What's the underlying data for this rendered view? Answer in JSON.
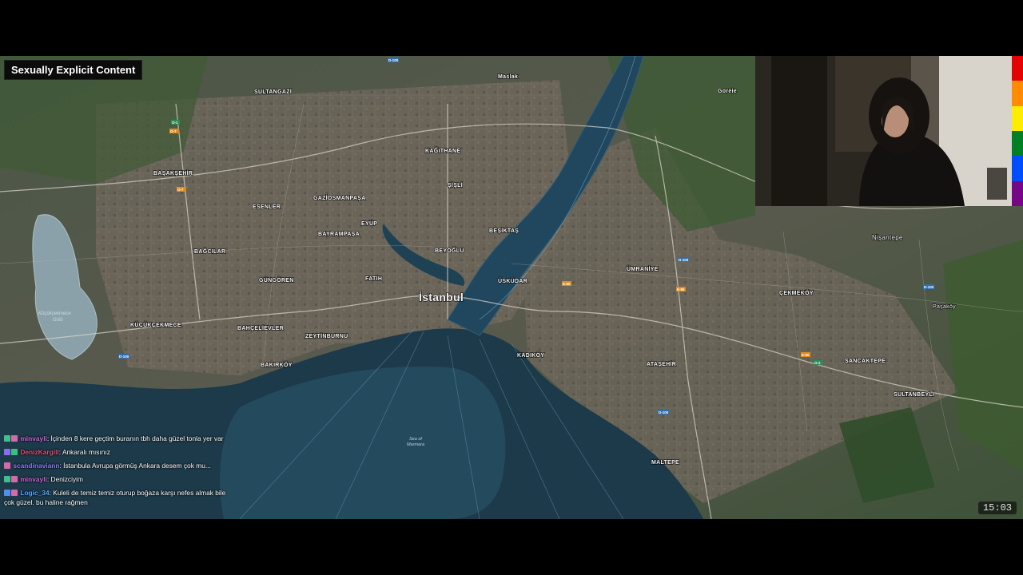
{
  "overlay": {
    "content_label": "Sexually Explicit Content",
    "clock": "15:03"
  },
  "map": {
    "city_label": "İstanbul",
    "sea_label_1": "Sea of",
    "sea_label_2": "Marmara",
    "lake_label_1": "Küçükçekmece",
    "lake_label_2": "Gölü",
    "district_labels": {
      "maslak": "Maslak",
      "sultangazi": "SULTANGAZİ",
      "basaksehir": "BAŞAKŞEHİR",
      "kagithane": "KAĞITHANE",
      "sisli": "ŞİŞLİ",
      "gaziosmanpasa": "GAZİOSMANPAŞA",
      "esenler": "ESENLER",
      "eyup": "EYÜP",
      "bayrampasa": "BAYRAMPAŞA",
      "besiktas": "BEŞİKTAŞ",
      "bagcilar": "BAĞCILAR",
      "beyoglu": "BEYOĞLU",
      "gungoren": "GÜNGÖREN",
      "fatih": "FATİH",
      "uskudar": "ÜSKÜDAR",
      "umraniye": "ÜMRANİYE",
      "kucukcekmece": "KÜÇÜKÇEKMECE",
      "bahcelievler": "BAHÇELİEVLER",
      "zeytinburnu": "ZEYTİNBURNU",
      "bakirkoy": "BAKIRKÖY",
      "kadikoy": "KADIKÖY",
      "atasehir": "ATAŞEHİR",
      "cekmekoy": "ÇEKMEKÖY",
      "sancaktepe": "SANCAKTEPE",
      "sultanbeyli": "SULTANBEYLİ",
      "maltepe": "MALTEPE",
      "nisantepe": "Nişantepe",
      "pasakoy": "Paşaköy",
      "goreie": "Goreie"
    },
    "highway_shields": [
      "O-1",
      "O-2",
      "O-3",
      "O-4",
      "O-7",
      "E-80",
      "D-100"
    ]
  },
  "chat": [
    {
      "user": "minvayli",
      "user_color": "#c86ad8",
      "badge_colors": [
        "#3fbf8f",
        "#d46aa8"
      ],
      "text": "İçinden 8 kere geçtim buranın tbh daha güzel tonla yer var"
    },
    {
      "user": "DenizKargill",
      "user_color": "#e0507a",
      "badge_colors": [
        "#8a6cf0",
        "#39c07a"
      ],
      "text": "Ankaralı mısınız"
    },
    {
      "user": "scandinaviann",
      "user_color": "#8a7cff",
      "badge_colors": [
        "#d46aa8"
      ],
      "text": "İstanbula Avrupa görmüş Ankara desem çok mu..."
    },
    {
      "user": "minvayli",
      "user_color": "#c86ad8",
      "badge_colors": [
        "#3fbf8f",
        "#d46aa8"
      ],
      "text": "Denizciyim"
    },
    {
      "user": "Logic_34",
      "user_color": "#5fa8ff",
      "badge_colors": [
        "#4f8ff0",
        "#d46aa8"
      ],
      "text": "Kuleli de temiz temiz oturup boğaza karşı nefes almak bile çok güzel. bu haline rağmen"
    }
  ],
  "rainbow_colors": [
    "#e40303",
    "#ff8c00",
    "#ffed00",
    "#008026",
    "#004dff",
    "#750787"
  ]
}
